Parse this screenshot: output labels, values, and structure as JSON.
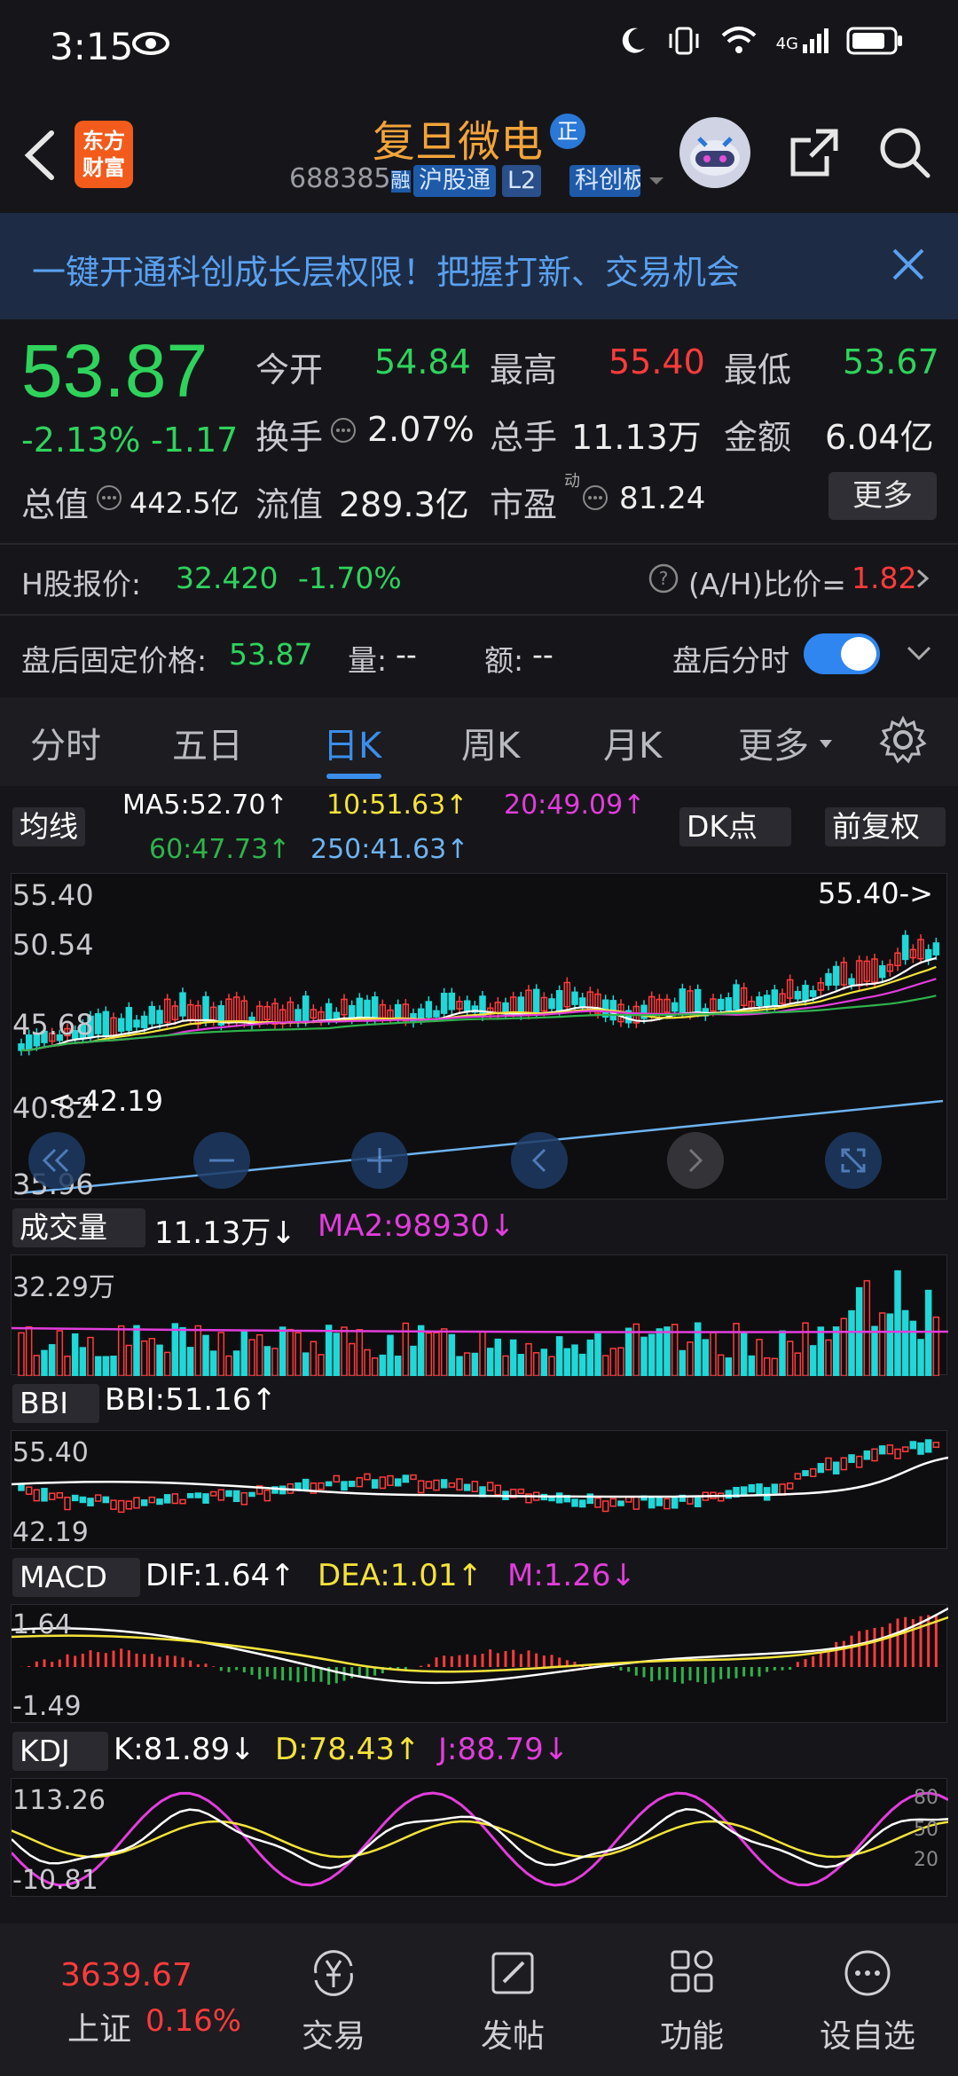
{
  "status": {
    "time": "3:15",
    "network": "4G",
    "colors": {
      "text": "#ffffff"
    }
  },
  "header": {
    "logo_text": "东方财富",
    "stock_name": "复旦微电",
    "badge": "正",
    "code": "688385",
    "code_suffix": "融",
    "tags": [
      "沪股通",
      "L2",
      "科创板"
    ]
  },
  "banner": {
    "text": "一键开通科创成长层权限！把握打新、交易机会"
  },
  "quote": {
    "price": "53.87",
    "change_pct": "-2.13%",
    "change": "-1.17",
    "open_label": "今开",
    "open": "54.84",
    "high_label": "最高",
    "high": "55.40",
    "low_label": "最低",
    "low": "53.67",
    "turnover_label": "换手",
    "turnover": "2.07%",
    "volume_label": "总手",
    "volume": "11.13万",
    "amount_label": "金额",
    "amount": "6.04亿",
    "total_cap_label": "总值",
    "total_cap": "442.5亿",
    "float_cap_label": "流值",
    "float_cap": "289.3亿",
    "pe_label": "市盈",
    "pe_sup": "动",
    "pe": "81.24",
    "more_label": "更多"
  },
  "hshare": {
    "label": "H股报价:",
    "price": "32.420",
    "change": "-1.70%",
    "ratio_label": "(A/H)比价=",
    "ratio": "1.82"
  },
  "afterhours": {
    "label": "盘后固定价格:",
    "price": "53.87",
    "qty_label": "量:",
    "qty": "--",
    "amt_label": "额:",
    "amt": "--",
    "intraday_label": "盘后分时",
    "toggle_on": true
  },
  "tabs": [
    "分时",
    "五日",
    "日K",
    "周K",
    "月K",
    "更多"
  ],
  "active_tab": "日K",
  "kline": {
    "ma_select": "均线",
    "ma5": "MA5:52.70↑",
    "ma10": "10:51.63↑",
    "ma20": "20:49.09↑",
    "ma60": "60:47.73↑",
    "ma250": "250:41.63↑",
    "dk_button": "DK点",
    "fq_button": "前复权",
    "axis": [
      "55.40",
      "50.54",
      "45.68",
      "40.82",
      "35.96"
    ],
    "hi_marker": "55.40->",
    "lo_marker": "<-42.19",
    "colors": {
      "ma5": "#ffffff",
      "ma10": "#f5e33a",
      "ma20": "#e23ddc",
      "ma60": "#2fb34c",
      "ma250": "#6db3f2"
    }
  },
  "volume": {
    "select": "成交量",
    "value": "11.13万↓",
    "ma": "MA2:98930↓",
    "axis_top": "32.29万"
  },
  "bbi": {
    "select": "BBI",
    "value": "BBI:51.16↑",
    "axis": [
      "55.40",
      "42.19"
    ]
  },
  "macd": {
    "select": "MACD",
    "dif": "DIF:1.64↑",
    "dea": "DEA:1.01↑",
    "m": "M:1.26↓",
    "axis": [
      "1.64",
      "-1.49"
    ]
  },
  "kdj": {
    "select": "KDJ",
    "k": "K:81.89↓",
    "d": "D:78.43↑",
    "j": "J:88.79↓",
    "axis": [
      "113.26",
      "-10.81"
    ],
    "levels": [
      "80",
      "50",
      "20"
    ]
  },
  "bottom_nav": {
    "index_value": "3639.67",
    "index_name": "上证",
    "index_change": "0.16%",
    "items": [
      "交易",
      "发帖",
      "功能",
      "设自选"
    ]
  }
}
